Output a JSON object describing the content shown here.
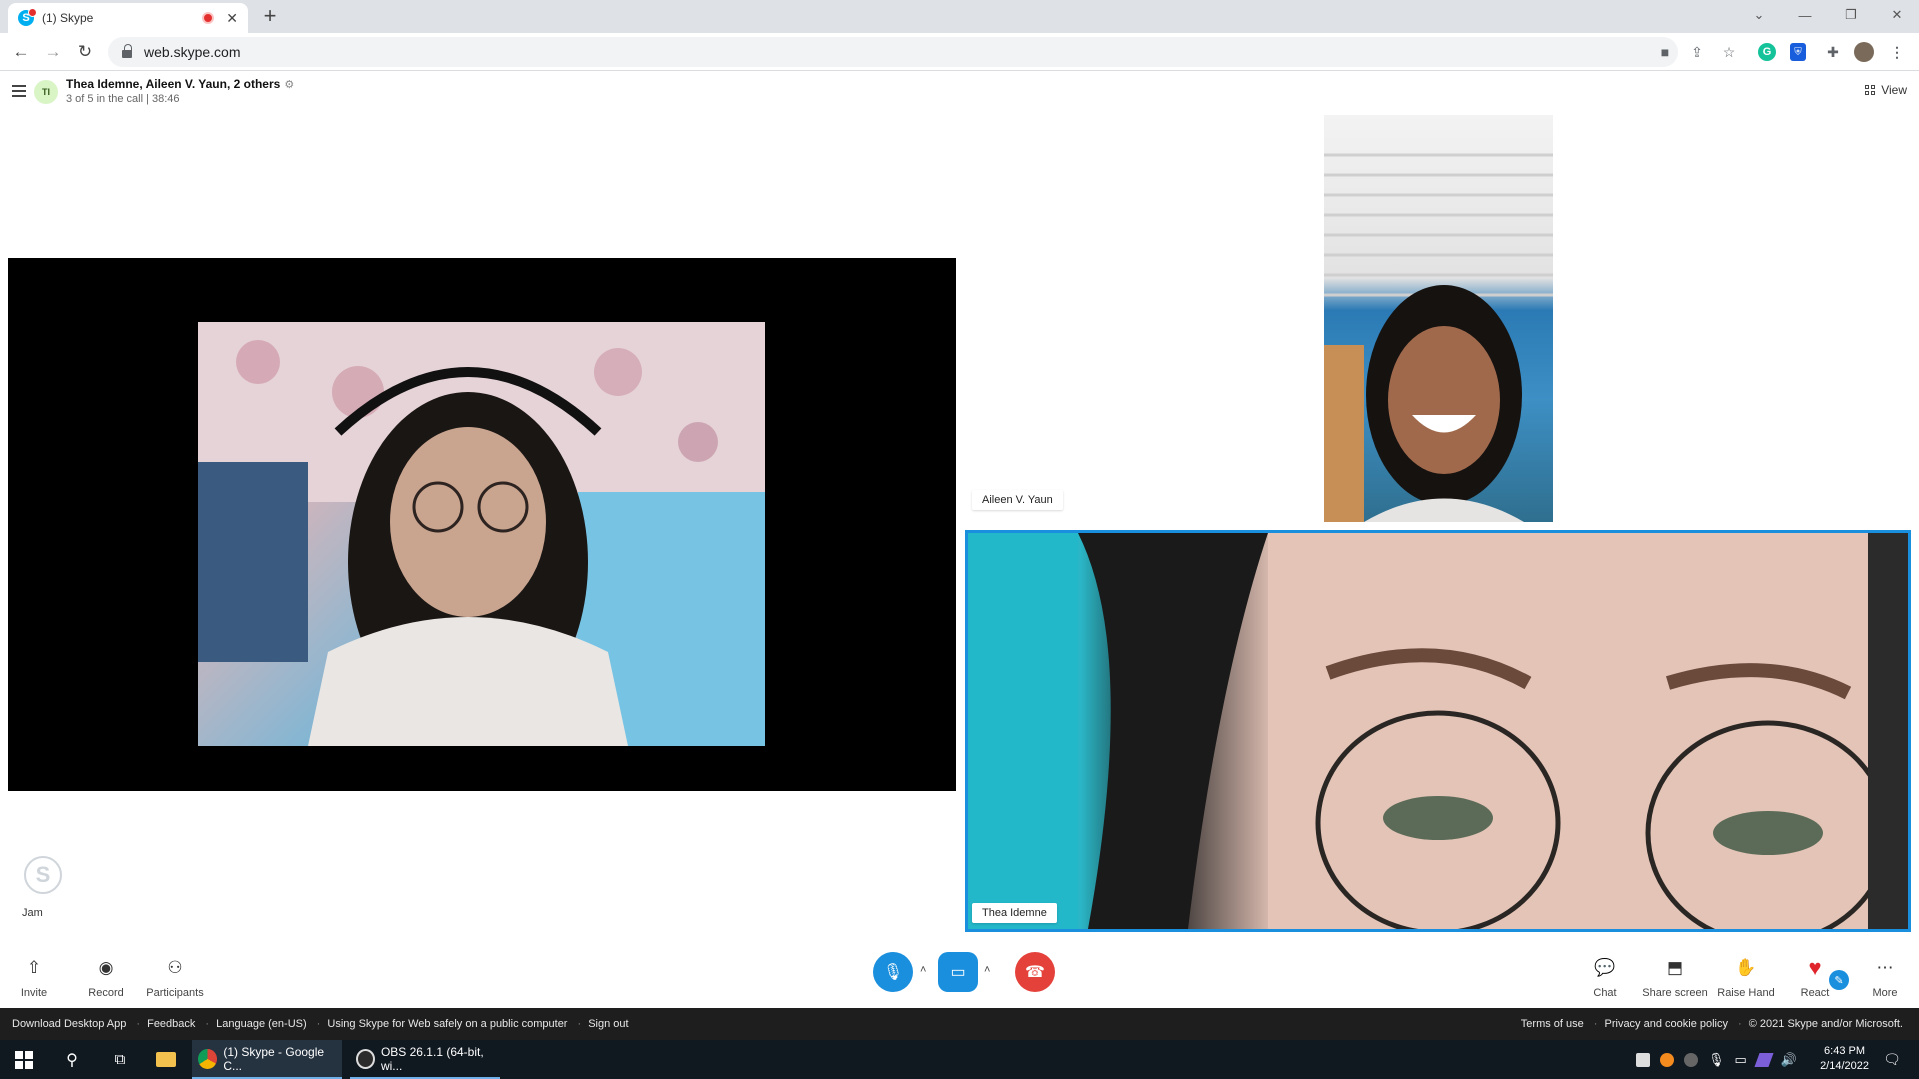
{
  "browser": {
    "tab_title": "(1) Skype",
    "favicon_letter": "S",
    "url": "web.skype.com"
  },
  "conversation": {
    "avatar_initials": "TI",
    "title": "Thea Idemne, Aileen V. Yaun, 2 others",
    "subtitle": "3 of 5 in the call | 38:46",
    "view_label": "View"
  },
  "participants": {
    "side_name": "Aileen V. Yaun",
    "focus_name": "Thea Idemne",
    "self_name": "Jam",
    "self_avatar_letter": "S"
  },
  "controls": {
    "invite": "Invite",
    "record": "Record",
    "participants": "Participants",
    "chat": "Chat",
    "share_screen": "Share screen",
    "raise_hand": "Raise Hand",
    "react": "React",
    "more": "More"
  },
  "footer": {
    "left_links": [
      "Download Desktop App",
      "Feedback",
      "Language (en-US)",
      "Using Skype for Web safely on a public computer",
      "Sign out"
    ],
    "right_links": [
      "Terms of use",
      "Privacy and cookie policy",
      "© 2021 Skype and/or Microsoft."
    ]
  },
  "taskbar": {
    "app1": "(1) Skype - Google C...",
    "app2": "OBS 26.1.1 (64-bit, wi...",
    "time": "6:43 PM",
    "date": "2/14/2022"
  },
  "colors": {
    "skype_blue": "#00aff0",
    "mic_button": "#1a8fdd",
    "hangup": "#e5413b",
    "focus_border": "#1a8fdd",
    "react_heart": "#e0242b"
  }
}
